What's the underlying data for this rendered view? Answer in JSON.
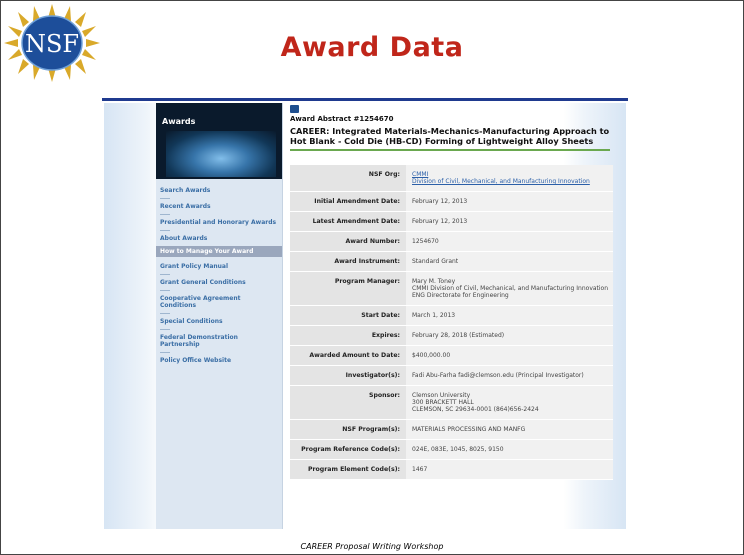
{
  "slide": {
    "title": "Award Data",
    "footer": "CAREER Proposal Writing Workshop",
    "logo_text": "NSF"
  },
  "sidebar": {
    "banner_label": "Awards",
    "items": [
      "Search Awards",
      "Recent Awards",
      "Presidential and Honorary Awards",
      "About Awards"
    ],
    "section_header": "How to Manage Your Award",
    "manage_items": [
      "Grant Policy Manual",
      "Grant General Conditions",
      "Cooperative Agreement Conditions",
      "Special Conditions",
      "Federal Demonstration Partnership",
      "Policy Office Website"
    ]
  },
  "abstract": {
    "heading": "Award Abstract #1254670",
    "title": "CAREER: Integrated Materials-Mechanics-Manufacturing Approach to Hot Blank - Cold Die (HB-CD) Forming of Lightweight Alloy Sheets"
  },
  "fields": [
    {
      "label": "NSF Org:",
      "value": "CMMI",
      "link2": "Division of Civil, Mechanical, and Manufacturing Innovation"
    },
    {
      "label": "Initial Amendment Date:",
      "value": "February 12, 2013"
    },
    {
      "label": "Latest Amendment Date:",
      "value": "February 12, 2013"
    },
    {
      "label": "Award Number:",
      "value": "1254670"
    },
    {
      "label": "Award Instrument:",
      "value": "Standard Grant"
    },
    {
      "label": "Program Manager:",
      "value": "Mary M. Toney",
      "extra": [
        "CMMI Division of Civil, Mechanical, and Manufacturing Innovation",
        "ENG Directorate for Engineering"
      ]
    },
    {
      "label": "Start Date:",
      "value": "March 1, 2013"
    },
    {
      "label": "Expires:",
      "value": "February 28, 2018 (Estimated)"
    },
    {
      "label": "Awarded Amount to Date:",
      "value": "$400,000.00"
    },
    {
      "label": "Investigator(s):",
      "value": "Fadi Abu-Farha fadi@clemson.edu (Principal Investigator)"
    },
    {
      "label": "Sponsor:",
      "value": "Clemson University",
      "extra": [
        "300 BRACKETT HALL",
        "CLEMSON, SC 29634-0001 (864)656-2424"
      ]
    },
    {
      "label": "NSF Program(s):",
      "value": "MATERIALS PROCESSING AND MANFG"
    },
    {
      "label": "Program Reference Code(s):",
      "value": "024E, 083E, 1045, 8025, 9150"
    },
    {
      "label": "Program Element Code(s):",
      "value": "1467"
    }
  ],
  "colors": {
    "title": "#c0261a",
    "rule": "#1f3a8f",
    "link": "#2b5fa8"
  }
}
